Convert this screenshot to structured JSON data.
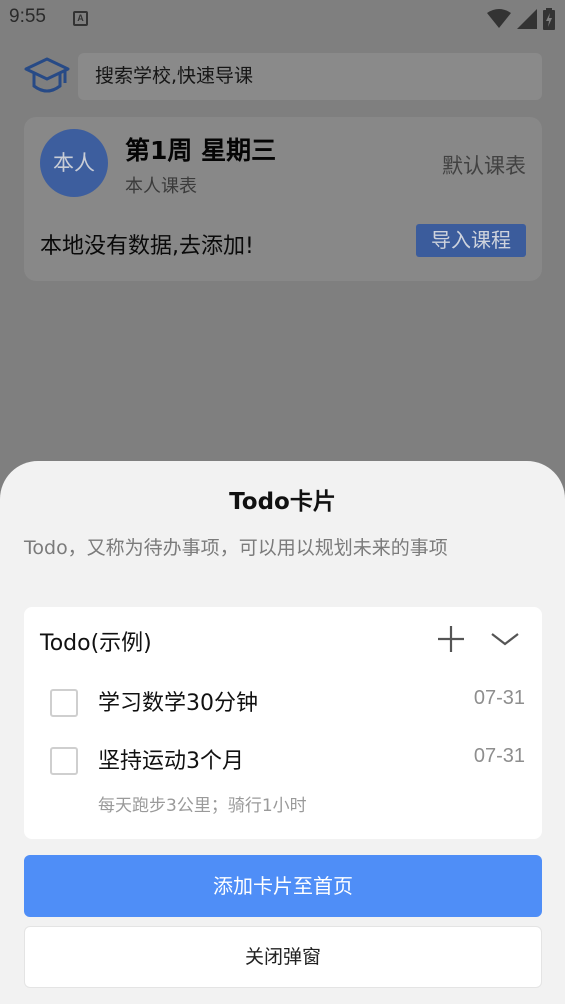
{
  "status_bar": {
    "time": "9:55",
    "notification_letter": "A",
    "icons": [
      "wifi-icon",
      "signal-icon",
      "battery-charging-icon"
    ]
  },
  "search": {
    "placeholder": "搜索学校,快速导课"
  },
  "schedule": {
    "avatar_text": "本人",
    "week_title": "第1周  星期三",
    "subtitle": "本人课表",
    "default_table_label": "默认课表",
    "empty_message": "本地没有数据,去添加!",
    "import_button": "导入课程"
  },
  "sheet": {
    "title": "Todo卡片",
    "description": "Todo，又称为待办事项，可以用以规划未来的事项",
    "card": {
      "title": "Todo(示例)",
      "items": [
        {
          "text": "学习数学30分钟",
          "date": "07-31",
          "checked": false
        },
        {
          "text": "坚持运动3个月",
          "date": "07-31",
          "checked": false,
          "note": "每天跑步3公里；骑行1小时"
        }
      ]
    },
    "add_button": "添加卡片至首页",
    "close_button": "关闭弹窗"
  },
  "colors": {
    "accent": "#4f8ef7",
    "overlay_background": "#7f7f7f",
    "sheet_background": "#f2f2f2"
  }
}
